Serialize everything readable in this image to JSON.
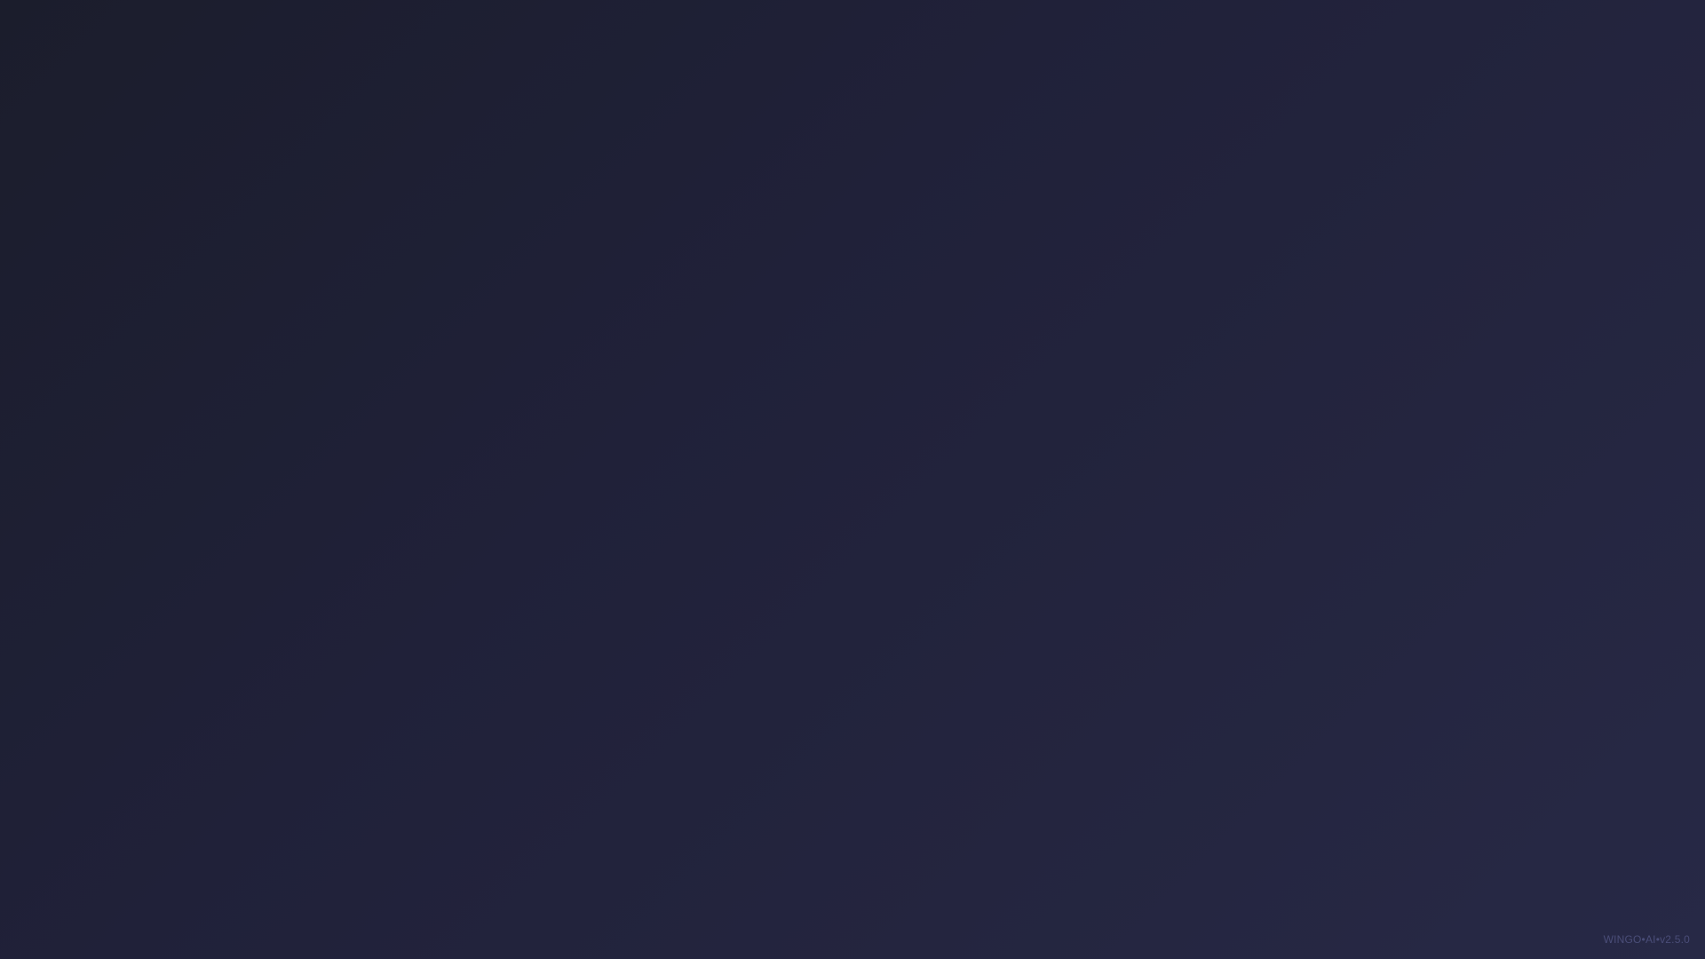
{
  "background": {
    "gradient_start": "#1b1d2c",
    "gradient_mid": "#202139",
    "gradient_end": "#272946"
  },
  "footer": {
    "version_text": "WINGO•AI•v2.5.0",
    "version_color": "#4a4d78"
  }
}
